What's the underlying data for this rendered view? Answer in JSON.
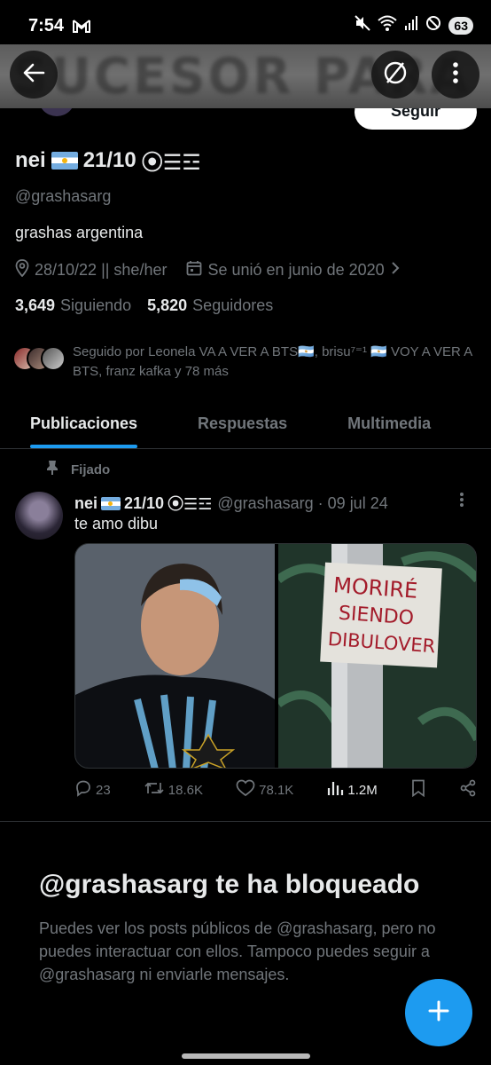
{
  "status_bar": {
    "time": "7:54",
    "battery": "63"
  },
  "header": {
    "banner_text": "SUCESOR PARA"
  },
  "profile": {
    "name_prefix": "nei",
    "name_suffix": "21/10",
    "name_symbols": "⦿☰☲",
    "handle": "@grashasarg",
    "bio": "grashas argentina",
    "location": "28/10/22 || she/her",
    "joined": "Se unió en junio de 2020",
    "following_count": "3,649",
    "following_label": "Siguiendo",
    "followers_count": "5,820",
    "followers_label": "Seguidores",
    "followed_by": "Seguido por Leonela VA A VER A BTS🇦🇷, brisu⁷⁼¹ 🇦🇷 VOY A VER A BTS, franz kafka y 78 más",
    "follow_button": "Seguir"
  },
  "tabs": [
    {
      "label": "Publicaciones",
      "active": true
    },
    {
      "label": "Respuestas",
      "active": false
    },
    {
      "label": "Multimedia",
      "active": false
    }
  ],
  "tweet": {
    "pinned_label": "Fijado",
    "author_prefix": "nei",
    "author_suffix": "21/10",
    "author_symbols": "⦿☰☲",
    "handle_date": "@grashasarg · 09 jul 24",
    "text": "te amo dibu",
    "sign_text": "MORIRÉ SIENDO DIBULOVER",
    "replies": "23",
    "reposts": "18.6K",
    "likes": "78.1K",
    "views": "1.2M"
  },
  "blocked": {
    "title": "@grashasarg te ha bloqueado",
    "description": "Puedes ver los posts públicos de @grashasarg, pero no puedes interactuar con ellos. Tampoco puedes seguir a @grashasarg ni enviarle mensajes."
  },
  "colors": {
    "accent": "#1d9bf0",
    "background": "#000000",
    "text": "#e7e9ea",
    "muted": "#71767b"
  }
}
